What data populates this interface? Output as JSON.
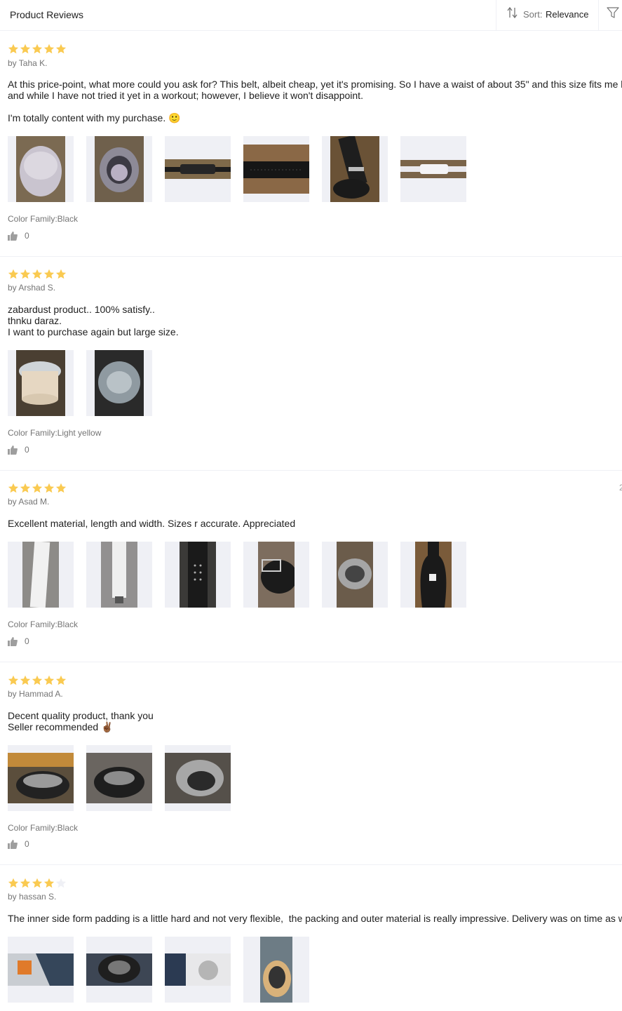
{
  "header": {
    "title": "Product Reviews",
    "sort_label": "Sort:",
    "sort_value": "Relevance"
  },
  "colors": {
    "star_filled": "#faca51",
    "star_empty": "#eff0f5",
    "border": "#eff0f5"
  },
  "reviews": [
    {
      "rating": 5,
      "author": "by Taha K.",
      "content": "At this price-point, what more could you ask for? This belt, albeit cheap, yet it's promising. So I have a waist of about 35\" and this size fits me l\nand while I have not tried it yet in a workout; however, I believe it won't disappoint.\n\nI'm totally content with my purchase. 🙂",
      "sku": "Color Family:Black",
      "likes": "0",
      "date": ""
    },
    {
      "rating": 5,
      "author": "by Arshad S.",
      "content": "zabardust product.. 100% satisfy..\nthnku daraz.\nI want to purchase again but large size.",
      "sku": "Color Family:Light yellow",
      "likes": "0",
      "date": ""
    },
    {
      "rating": 5,
      "author": "by Asad M.",
      "content": "Excellent material, length and width. Sizes r accurate. Appreciated",
      "sku": "Color Family:Black",
      "likes": "0",
      "date": "2"
    },
    {
      "rating": 5,
      "author": "by Hammad A.",
      "content": "Decent quality product, thank you\nSeller recommended ✌🏾",
      "sku": "Color Family:Black",
      "likes": "0",
      "date": ""
    },
    {
      "rating": 4,
      "author": "by hassan S.",
      "content": "The inner side form padding is a little hard and not very flexible,  the packing and outer material is really impressive. Delivery was on time as w",
      "sku": "",
      "likes": "",
      "date": ""
    }
  ]
}
